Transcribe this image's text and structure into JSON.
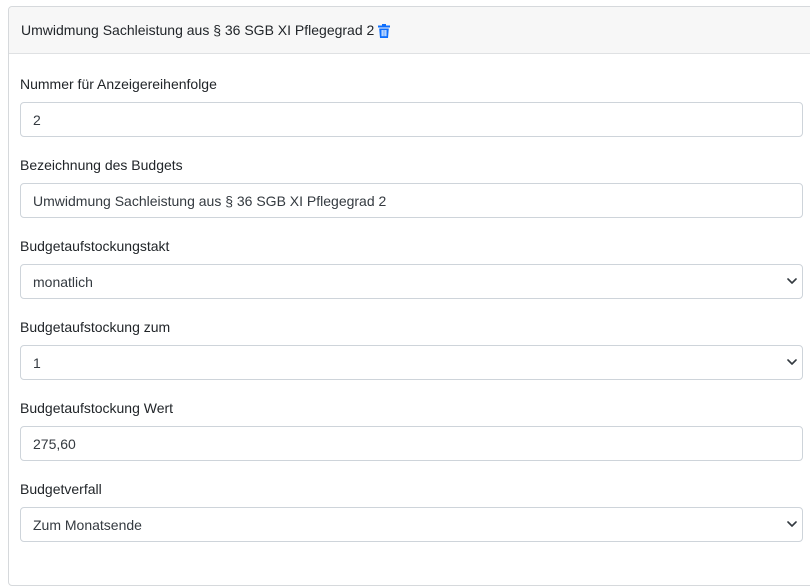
{
  "header": {
    "title": "Umwidmung Sachleistung aus § 36 SGB XI Pflegegrad 2",
    "trash_icon": "trash-icon",
    "accent_color": "#0d6efd"
  },
  "form": {
    "order_number": {
      "label": "Nummer für Anzeigereihenfolge",
      "value": "2"
    },
    "budget_name": {
      "label": "Bezeichnung des Budgets",
      "value": "Umwidmung Sachleistung aus § 36 SGB XI Pflegegrad 2"
    },
    "topup_cycle": {
      "label": "Budgetaufstockungstakt",
      "value": "monatlich"
    },
    "topup_on": {
      "label": "Budgetaufstockung zum",
      "value": "1"
    },
    "topup_value": {
      "label": "Budgetaufstockung Wert",
      "value": "275,60"
    },
    "expiry": {
      "label": "Budgetverfall",
      "value": "Zum Monatsende"
    }
  }
}
